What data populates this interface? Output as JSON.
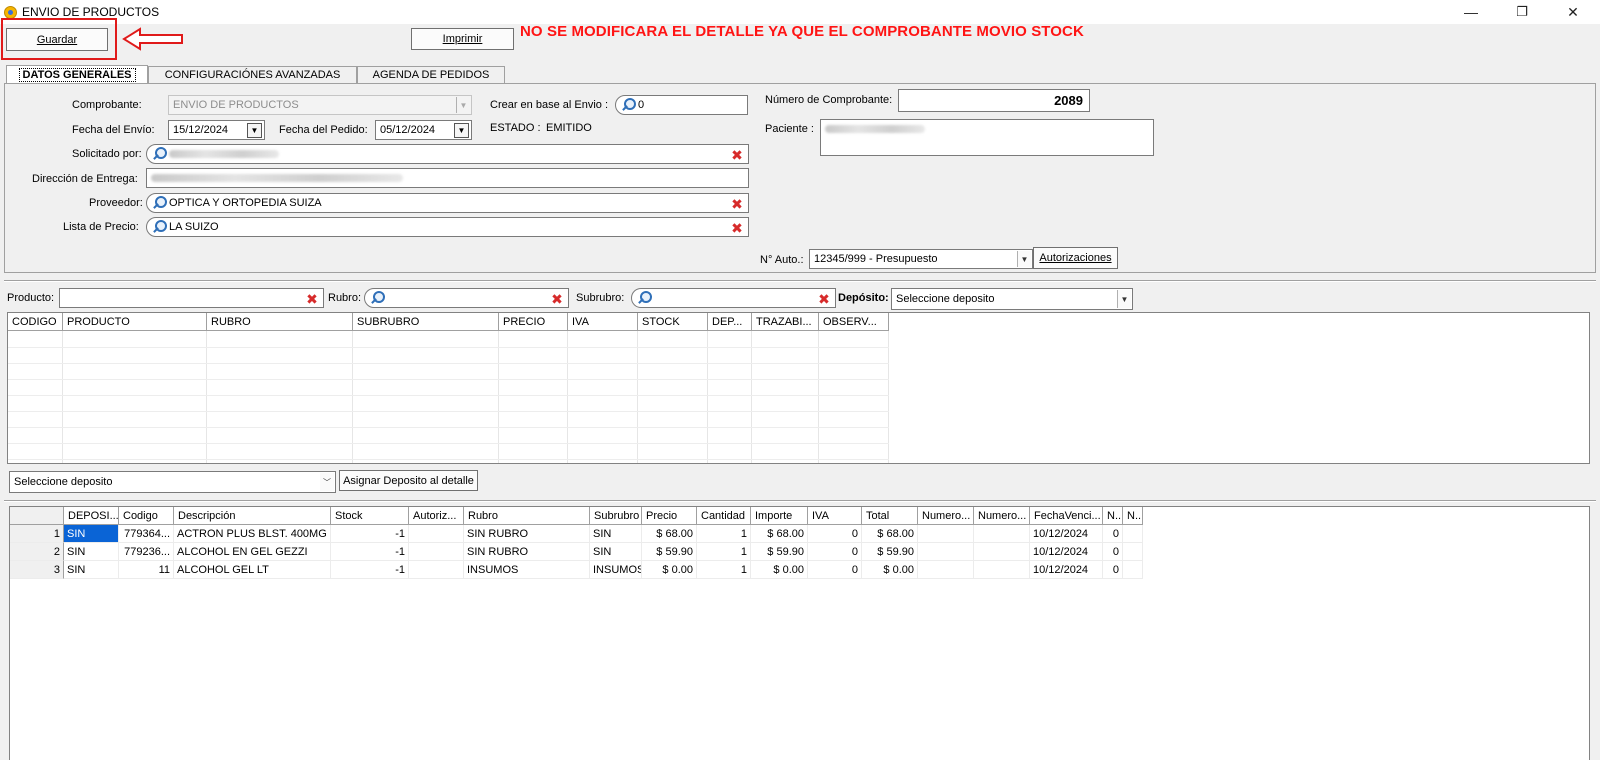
{
  "window": {
    "title": "ENVIO DE PRODUCTOS",
    "minimize": "—",
    "restore": "❐",
    "close": "✕"
  },
  "toolbar": {
    "save_label": "Guardar",
    "print_label": "Imprimir"
  },
  "warning": "NO SE MODIFICARA EL DETALLE YA QUE EL COMPROBANTE MOVIO STOCK",
  "colors": {
    "warning": "#ff1414",
    "highlight": "#e01a1a",
    "selection": "#0a64d6"
  },
  "tabs": [
    "DATOS GENERALES",
    "CONFIGURACIÓNES AVANZADAS",
    "AGENDA DE PEDIDOS"
  ],
  "form": {
    "comprobante_label": "Comprobante:",
    "comprobante_value": "ENVIO DE PRODUCTOS",
    "fecha_envio_label": "Fecha del Envío:",
    "fecha_envio_value": "15/12/2024",
    "fecha_pedido_label": "Fecha del Pedido:",
    "fecha_pedido_value": "05/12/2024",
    "crear_label": "Crear en base al Envio :",
    "crear_value": "0",
    "estado_label": "ESTADO :",
    "estado_value": "EMITIDO",
    "numero_label": "Número de Comprobante:",
    "numero_value": "2089",
    "paciente_label": "Paciente :",
    "solicitado_label": "Solicitado por:",
    "direccion_label": "Dirección de Entrega:",
    "proveedor_label": "Proveedor:",
    "proveedor_value": "OPTICA Y ORTOPEDIA SUIZA",
    "lista_label": "Lista de Precio:",
    "lista_value": "LA SUIZO",
    "nauto_label": "N° Auto.:",
    "nauto_value": "12345/999 - Presupuesto",
    "autorizaciones_label": "Autorizaciones"
  },
  "filters": {
    "producto_label": "Producto:",
    "rubro_label": "Rubro:",
    "subrubro_label": "Subrubro:",
    "deposito_label": "Depósito:",
    "deposito_value": "Seleccione deposito"
  },
  "product_grid": {
    "columns": [
      "CODIGO",
      "PRODUCTO",
      "RUBRO",
      "SUBRUBRO",
      "PRECIO",
      "IVA",
      "STOCK",
      "DEP...",
      "TRAZABI...",
      "OBSERV..."
    ]
  },
  "assign": {
    "deposito_value": "Seleccione deposito",
    "button_label": "Asignar Deposito al detalle"
  },
  "detail_grid": {
    "columns": [
      "DEPOSI...",
      "Codigo",
      "Descripción",
      "Stock",
      "Autoriz...",
      "Rubro",
      "Subrubro",
      "Precio",
      "Cantidad",
      "Importe",
      "IVA",
      "Total",
      "Numero...",
      "Numero...",
      "FechaVenci...",
      "N...",
      "N..."
    ],
    "rows": [
      [
        "1",
        "SIN",
        "779364...",
        "ACTRON PLUS BLST. 400MG",
        "-1",
        "",
        "SIN RUBRO",
        "SIN",
        "$ 68.00",
        "1",
        "$ 68.00",
        "0",
        "$ 68.00",
        "",
        "",
        "10/12/2024",
        "0",
        ""
      ],
      [
        "2",
        "SIN",
        "779236...",
        "ALCOHOL EN GEL GEZZI",
        "-1",
        "",
        "SIN RUBRO",
        "SIN",
        "$ 59.90",
        "1",
        "$ 59.90",
        "0",
        "$ 59.90",
        "",
        "",
        "10/12/2024",
        "0",
        ""
      ],
      [
        "3",
        "SIN",
        "11",
        "ALCOHOL GEL LT",
        "-1",
        "",
        "INSUMOS",
        "INSUMOS",
        "$ 0.00",
        "1",
        "$ 0.00",
        "0",
        "$ 0.00",
        "",
        "",
        "10/12/2024",
        "0",
        ""
      ]
    ]
  }
}
